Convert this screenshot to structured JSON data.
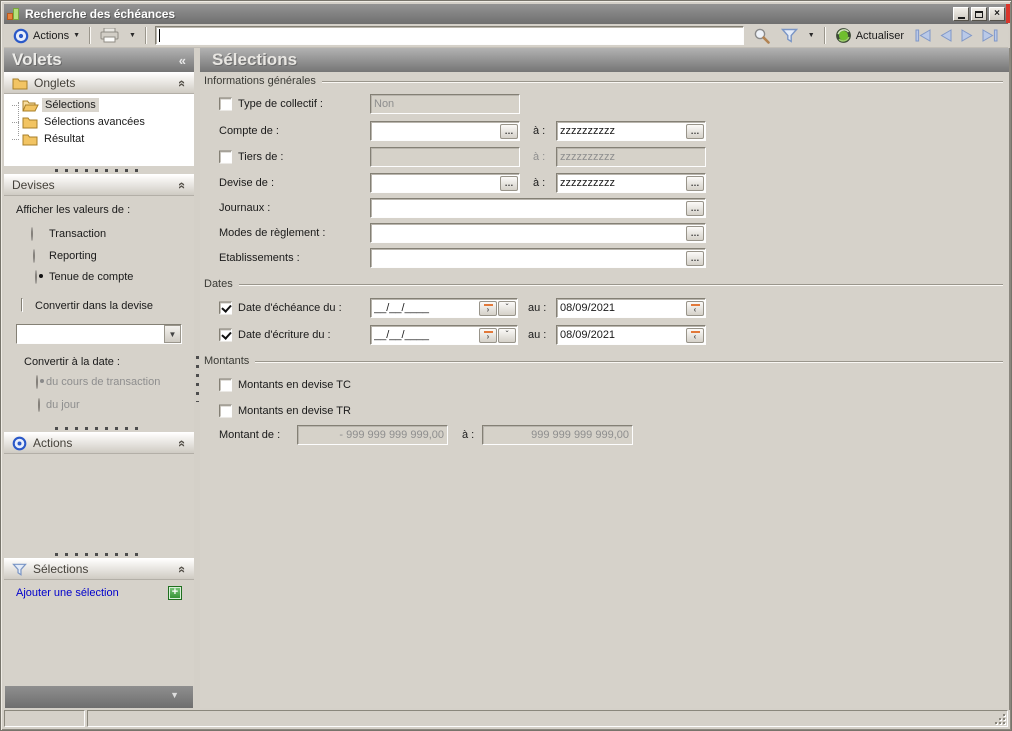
{
  "window": {
    "title": "Recherche des échéances"
  },
  "icons": {
    "collapse_left": "«",
    "chevron_up_double": "«",
    "dropdown_arrow": "▼",
    "small_dropdown": "▼",
    "chevron_down": "ˇ",
    "ellipsis": "…",
    "date_next": "›",
    "date_prev": "‹",
    "close": "×",
    "plus": "+"
  },
  "toolbar": {
    "actions_label": "Actions",
    "actualiser_label": "Actualiser",
    "search_value": ""
  },
  "sidebar": {
    "title": "Volets",
    "onglets": {
      "label": "Onglets",
      "items": [
        {
          "label": "Sélections",
          "selected": true
        },
        {
          "label": "Sélections avancées",
          "selected": false
        },
        {
          "label": "Résultat",
          "selected": false
        }
      ]
    },
    "devises": {
      "label": "Devises",
      "afficher_label": "Afficher les valeurs de :",
      "radio_transaction": "Transaction",
      "radio_reporting": "Reporting",
      "radio_tenue": "Tenue de compte",
      "selected_radio": "Tenue de compte",
      "convertir_checkbox_label": "Convertir dans la devise",
      "convertir_checked": false,
      "combo_value": "",
      "convertir_date_label": "Convertir à la date :",
      "radio_cours": "du cours de transaction",
      "radio_jour": "du jour",
      "date_selected_radio": "du cours de transaction"
    },
    "actions_label": "Actions",
    "selections_label": "Sélections",
    "add_selection_label": "Ajouter une sélection"
  },
  "main": {
    "header": "Sélections",
    "a_label": "à :",
    "au_label": "au :",
    "infos": {
      "legend": "Informations générales",
      "type_collectif_label": "Type de collectif :",
      "type_collectif_value": "Non",
      "type_collectif_checked": false,
      "compte_label": "Compte de :",
      "compte_from": "",
      "compte_to": "zzzzzzzzzz",
      "tiers_label": "Tiers de :",
      "tiers_checked": false,
      "tiers_from": "",
      "tiers_to": "zzzzzzzzzz",
      "devise_label": "Devise de :",
      "devise_from": "",
      "devise_to": "zzzzzzzzzz",
      "journaux_label": "Journaux :",
      "journaux_value": "",
      "modes_label": "Modes de règlement :",
      "modes_value": "",
      "etablissements_label": "Etablissements :",
      "etablissements_value": ""
    },
    "dates": {
      "legend": "Dates",
      "echeance_label": "Date d'échéance du :",
      "echeance_checked": true,
      "echeance_from": "__/__/____",
      "echeance_to": "08/09/2021",
      "ecriture_label": "Date d'écriture du :",
      "ecriture_checked": true,
      "ecriture_from": "__/__/____",
      "ecriture_to": "08/09/2021"
    },
    "montants": {
      "legend": "Montants",
      "tc_label": "Montants en devise TC",
      "tc_checked": false,
      "tr_label": "Montants en devise TR",
      "tr_checked": false,
      "montant_label": "Montant de :",
      "montant_from": "- 999 999 999 999,00",
      "montant_to": "999 999 999 999,00"
    }
  },
  "colors": {
    "accent_orange": "#e2793a",
    "link_blue": "#0000cc",
    "nav_arrow_fill": "#b9c9e8",
    "title_bar_gray": "#7e7e7e",
    "status_red": "#d9362b"
  }
}
